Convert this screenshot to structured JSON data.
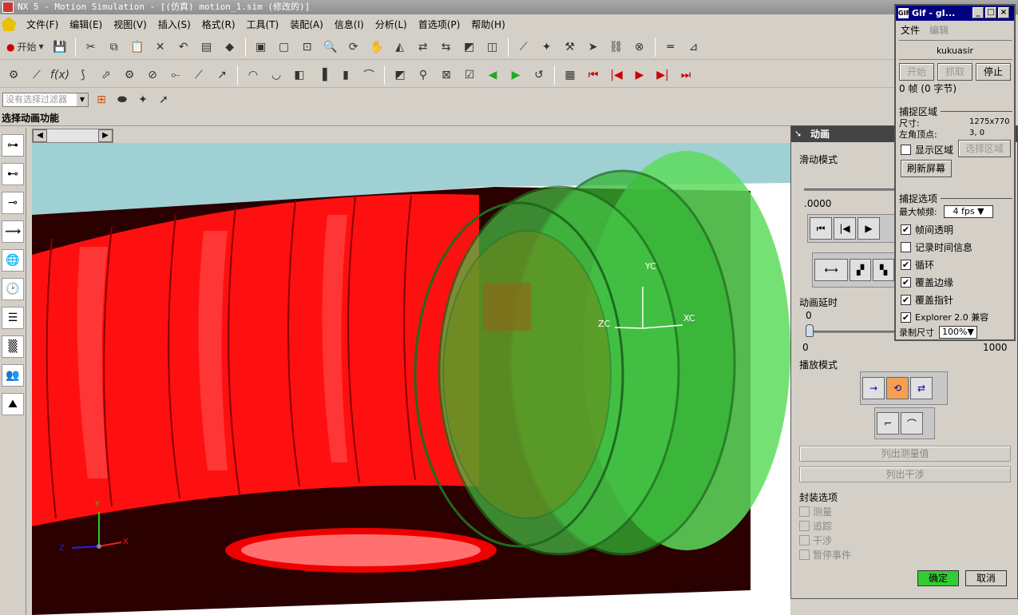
{
  "window": {
    "title": "NX 5 - Motion Simulation - [(仿真) motion_1.sim (修改的)]"
  },
  "menu": [
    "文件(F)",
    "编辑(E)",
    "视图(V)",
    "插入(S)",
    "格式(R)",
    "工具(T)",
    "装配(A)",
    "信息(I)",
    "分析(L)",
    "首选项(P)",
    "帮助(H)"
  ],
  "toolbar": {
    "start_label": "开始"
  },
  "filter": {
    "value": "没有选择过滤器"
  },
  "status": {
    "prompt": "选择动画功能"
  },
  "viewport_axes": {
    "y": "Y",
    "x": "X",
    "z": "Z",
    "yc": "YC",
    "xc": "XC",
    "zc": "ZC"
  },
  "anim_dialog": {
    "title": "动画",
    "slide_mode": "滑动模式",
    "time_value": ".0000",
    "delay_label": "动画延时",
    "delay_value": "0",
    "delay_min": "0",
    "delay_max": "1000",
    "play_mode": "播放模式",
    "list_measure": "列出测量值",
    "list_interference": "列出干涉",
    "package_options": "封装选项",
    "package_items": [
      "测量",
      "追踪",
      "干涉",
      "暂停事件"
    ],
    "ok": "确定",
    "cancel": "取消"
  },
  "gif_window": {
    "title": "Gif - gI...",
    "menu": [
      "文件",
      "编辑"
    ],
    "user": "kukuasir",
    "btn_start": "开始",
    "btn_capture": "抓取",
    "btn_stop": "停止",
    "frames": "0 帧 (0 字节)",
    "capture_area": "捕捉区域",
    "size_label": "尺寸:",
    "size_value": "1275x770",
    "corner_label": "左角顶点:",
    "corner_value": "3, 0",
    "show_area": "显示区域",
    "select_area": "选择区域",
    "refresh": "刷新屏幕",
    "capture_opts": "捕捉选项",
    "max_fps_label": "最大帧频:",
    "max_fps_value": "4 fps",
    "opts": [
      "帧间透明",
      "记录时间信息",
      "循环",
      "覆盖边缘",
      "覆盖指针",
      "Explorer 2.0 兼容"
    ],
    "opts_checked": [
      true,
      false,
      true,
      true,
      true,
      true
    ],
    "rec_size_label": "录制尺寸",
    "rec_size_value": "100%"
  }
}
